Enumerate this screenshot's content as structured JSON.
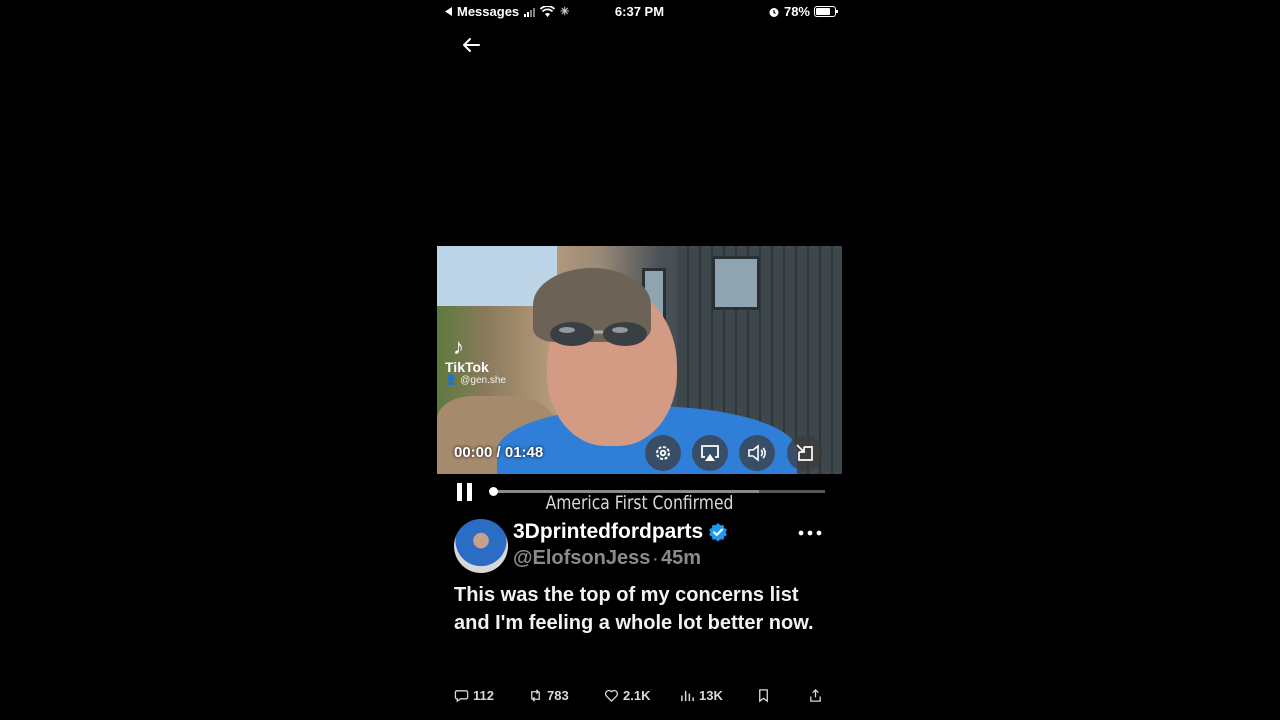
{
  "status_bar": {
    "back_app": "Messages",
    "time": "6:37 PM",
    "battery": "78%",
    "battery_level": 0.78
  },
  "nav": {
    "back_icon": "arrow-left-icon"
  },
  "video": {
    "watermark_brand": "TikTok",
    "watermark_handle": "@gen.she",
    "time_readout": "00:00 / 01:48",
    "progress": 0.0,
    "buffered": 0.8,
    "caption": "America First Confirmed",
    "controls": [
      "settings-icon",
      "airplay-icon",
      "volume-icon",
      "picture-in-picture-icon"
    ]
  },
  "tweet": {
    "display_name": "3Dprintedfordparts",
    "verified": true,
    "handle": "@ElofsonJess",
    "separator": "·",
    "time_ago": "45m",
    "text": "This was the top of my concerns list and I'm feeling a whole lot better now.",
    "stats": {
      "replies": "112",
      "reposts": "783",
      "likes": "2.1K",
      "views": "13K"
    }
  },
  "colors": {
    "accent": "#1d9bf0",
    "background": "#000000",
    "muted": "#8b8b8b"
  }
}
